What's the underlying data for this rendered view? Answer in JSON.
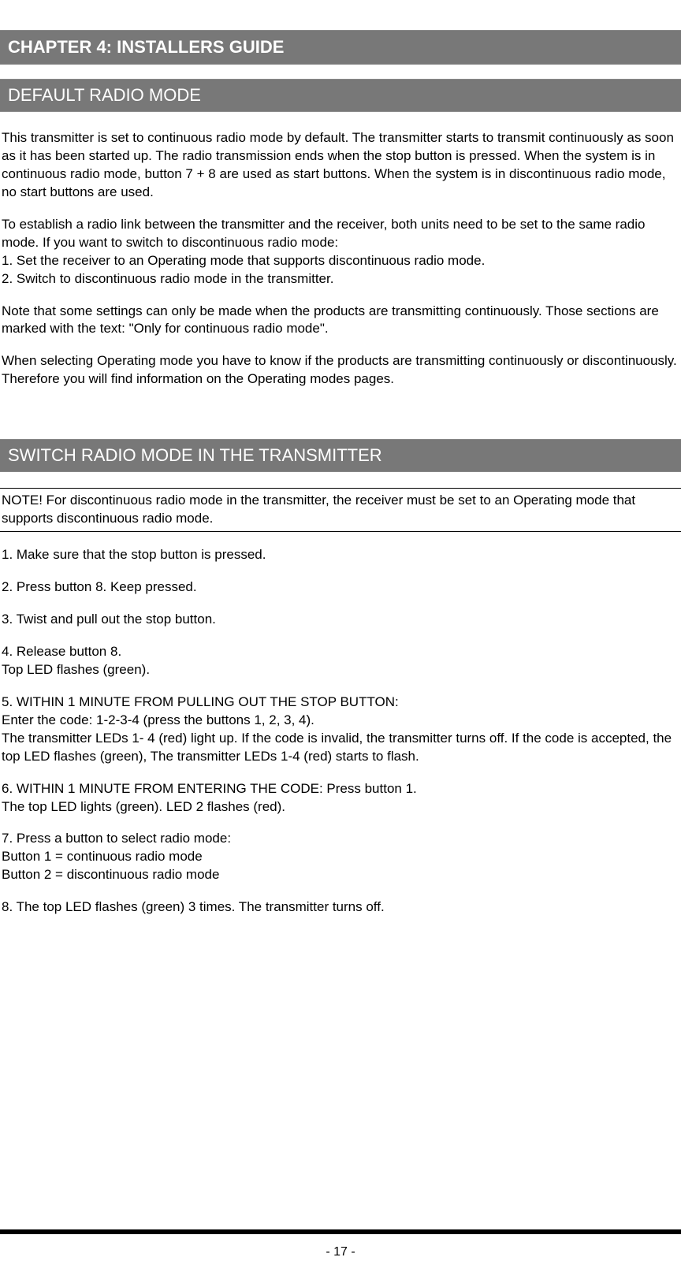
{
  "chapter": {
    "title": "CHAPTER 4: INSTALLERS GUIDE"
  },
  "section1": {
    "title": "DEFAULT RADIO MODE",
    "para1": "This transmitter is set to continuous radio mode by default. The transmitter starts to transmit continuously as soon as it has been started up. The radio transmission ends when the stop button is pressed. When the system is in continuous radio mode, button 7 + 8 are used as start buttons. When the system is in discontinuous radio mode, no start buttons are used.",
    "para2_intro": "To establish a radio link between the transmitter and the receiver, both units need to be set to the same radio mode. If you want to switch to discontinuous radio mode:",
    "para2_step1": "1. Set the receiver to an Operating mode that supports discontinuous radio mode.",
    "para2_step2": "2. Switch to discontinuous radio mode in the transmitter.",
    "para3": "Note that some settings can only be made when the products are transmitting continuously. Those sections are marked with the text: \"Only for continuous radio mode\".",
    "para4": "When selecting Operating mode you have to know if the products are transmitting continuously or discontinuously. Therefore you will find information on the Operating modes pages."
  },
  "section2": {
    "title": "SWITCH RADIO MODE IN THE TRANSMITTER",
    "note": "NOTE! For discontinuous radio mode in the transmitter, the receiver must be set to an Operating mode that supports discontinuous radio mode.",
    "step1": "1. Make sure that the stop button is pressed.",
    "step2": "2. Press button 8. Keep pressed.",
    "step3": "3. Twist and pull out the stop button.",
    "step4_a": "4. Release button 8.",
    "step4_b": "Top LED flashes (green).",
    "step5_a": "5. WITHIN 1 MINUTE FROM PULLING OUT THE STOP BUTTON:",
    "step5_b": "Enter the code: 1-2-3-4 (press the buttons 1, 2, 3, 4).",
    "step5_c": "The transmitter LEDs 1- 4 (red) light up. If the code is invalid, the transmitter turns off. If the code is accepted, the top LED flashes (green), The transmitter LEDs 1-4 (red) starts to flash.",
    "step6_a": "6. WITHIN 1 MINUTE FROM ENTERING THE CODE: Press button 1.",
    "step6_b": "The top LED lights (green). LED 2 flashes (red).",
    "step7_a": "7. Press a button to select radio mode:",
    "step7_b": "Button 1 = continuous radio mode",
    "step7_c": "Button 2 = discontinuous radio mode",
    "step8": "8. The top LED flashes (green) 3 times. The transmitter turns off."
  },
  "footer": {
    "page_number": "- 17 -"
  }
}
